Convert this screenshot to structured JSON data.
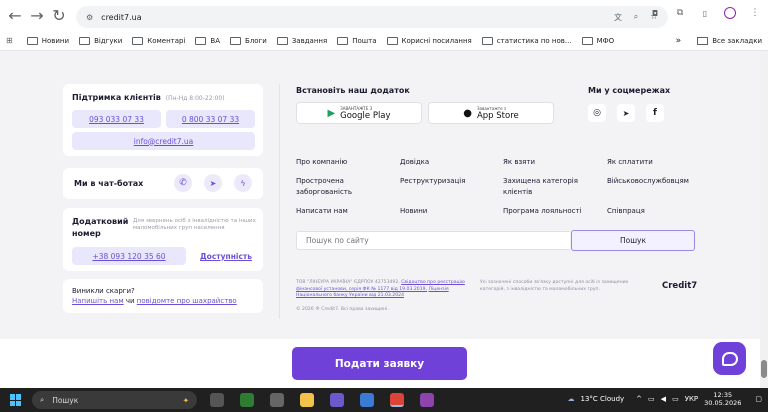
{
  "browser": {
    "url": "credit7.ua"
  },
  "bookmarks": {
    "items": [
      "Новини",
      "Відгуки",
      "Коментарі",
      "ВА",
      "Блоги",
      "Завдання",
      "Пошта",
      "Корисні посилання",
      "статистика по нов...",
      "МФО"
    ],
    "more": "»",
    "all": "Все закладки"
  },
  "support": {
    "title": "Підтримка клієнтів",
    "hours": "(Пн-Нд 8:00-22:00)",
    "phone1": "093 033 07 33",
    "phone2": "0 800 33 07 33",
    "email": "info@credit7.ua"
  },
  "chatbots": {
    "title": "Ми в чат-ботах"
  },
  "extra": {
    "title": "Додатковий номер",
    "note": "Для звернень осіб з інвалідністю та інших маломобільних груп населення",
    "phone": "+38 093 120 35 60",
    "accessibility": "Доступність"
  },
  "complaints": {
    "title": "Виникли скарги?",
    "link1": "Напишіть нам",
    "joiner": "чи",
    "link2": "повідомте про шахрайство"
  },
  "app": {
    "title": "Встановіть наш додаток",
    "gp_small": "ЗАВАНТАЖТЕ З",
    "gp_big": "Google Play",
    "as_small": "Завантажте з",
    "as_big": "App Store"
  },
  "social": {
    "title": "Ми у соцмережах"
  },
  "links": [
    [
      "Про компанію",
      "Довідка",
      "Як взяти",
      "Як сплатити"
    ],
    [
      "Прострочена заборгованість",
      "Реструктуризація",
      "Захищена категорія клієнтів",
      "Військовослужбовцям"
    ],
    [
      "Написати нам",
      "Новини",
      "Програма лояльності",
      "Співпраця"
    ]
  ],
  "search": {
    "placeholder": "Пошук по сайту",
    "button": "Пошук"
  },
  "legal": {
    "text1": "ТОВ \"ЛІНЕУРА УКРАЇНА\" ЄДРПОУ 42753492,",
    "link1": "Свідоцтво про реєстрацію фінансової установи, серія ФК № 1177 від 19.03.2019,",
    "link2": "Ліцензія Національного банку України від 21.03.2024",
    "note": "Усі зазначені способи зв'язку доступні для осіб із захищених категорій, з інвалідністю та маломобільних груп.",
    "copyright": "© 2026 ® Credit7. Всі права захищені.",
    "logo": "Credit7"
  },
  "cta": {
    "label": "Подати заявку"
  },
  "taskbar": {
    "search": "Пошук",
    "weather": "13°C  Cloudy",
    "lang": "УКР",
    "time": "12:35",
    "date": "30.05.2026"
  }
}
